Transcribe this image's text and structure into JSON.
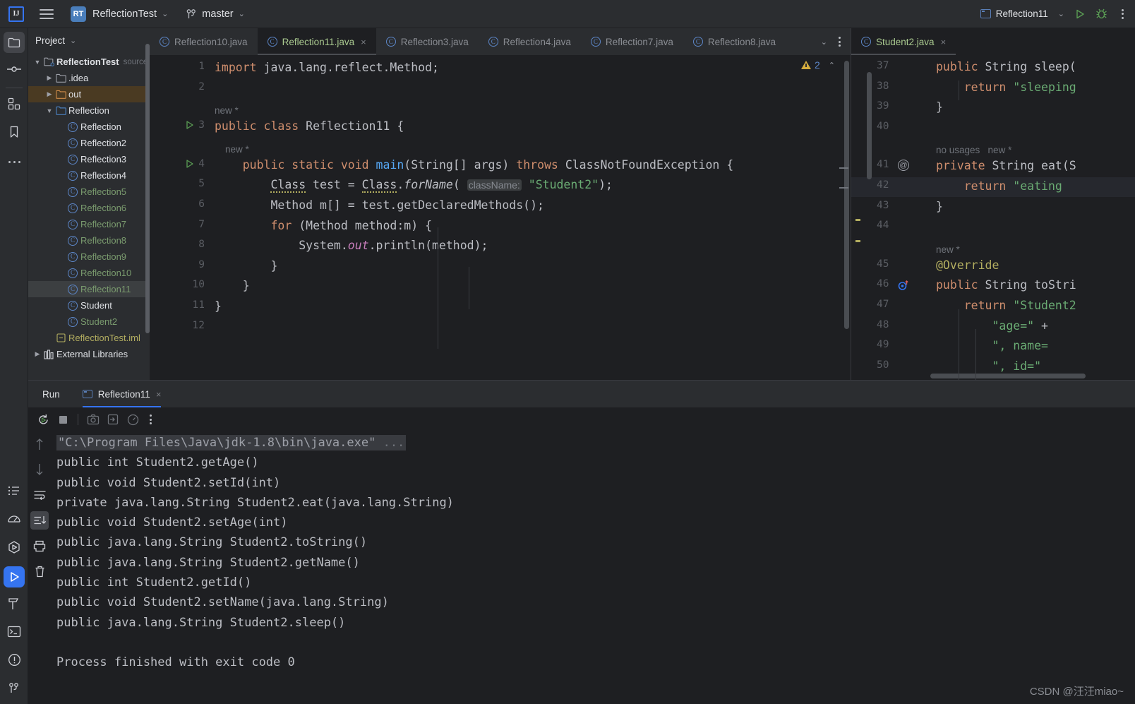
{
  "topbar": {
    "logo_text": "IJ",
    "menu_icon": "hamburger-menu-icon",
    "project_badge": "RT",
    "project_name": "ReflectionTest",
    "branch_name": "master",
    "run_config": "Reflection11",
    "run_icon": "run-play-icon",
    "debug_icon": "debug-bug-icon",
    "more_icon": "more-vertical-icon"
  },
  "stripe": {
    "top_items": [
      "project-icon",
      "commit-icon",
      "structure-icon",
      "bookmarks-icon",
      "more-tool-windows-icon"
    ],
    "bottom_items": [
      "todo-icon",
      "profiler-icon",
      "services-icon",
      "run-icon",
      "build-icon",
      "terminal-icon",
      "problems-icon",
      "git-icon"
    ]
  },
  "project_panel": {
    "title": "Project",
    "tree": [
      {
        "label": "ReflectionTest",
        "suffix": "source",
        "icon": "module-icon",
        "depth": 0,
        "arrow": "down",
        "style": "bold",
        "selected": "none"
      },
      {
        "label": ".idea",
        "suffix": "",
        "icon": "folder-icon",
        "depth": 1,
        "arrow": "right",
        "style": "normal",
        "selected": "none"
      },
      {
        "label": "out",
        "suffix": "",
        "icon": "folder-orange-icon",
        "depth": 1,
        "arrow": "right",
        "style": "normal",
        "selected": "out"
      },
      {
        "label": "Reflection",
        "suffix": "",
        "icon": "folder-blue-icon",
        "depth": 1,
        "arrow": "down",
        "style": "normal",
        "selected": "none"
      },
      {
        "label": "Reflection",
        "suffix": "",
        "icon": "class-icon",
        "depth": 2,
        "arrow": "",
        "style": "white",
        "selected": "none"
      },
      {
        "label": "Reflection2",
        "suffix": "",
        "icon": "class-icon",
        "depth": 2,
        "arrow": "",
        "style": "white",
        "selected": "none"
      },
      {
        "label": "Reflection3",
        "suffix": "",
        "icon": "class-icon",
        "depth": 2,
        "arrow": "",
        "style": "white",
        "selected": "none"
      },
      {
        "label": "Reflection4",
        "suffix": "",
        "icon": "class-icon",
        "depth": 2,
        "arrow": "",
        "style": "white",
        "selected": "none"
      },
      {
        "label": "Reflection5",
        "suffix": "",
        "icon": "class-icon",
        "depth": 2,
        "arrow": "",
        "style": "green",
        "selected": "none"
      },
      {
        "label": "Reflection6",
        "suffix": "",
        "icon": "class-icon",
        "depth": 2,
        "arrow": "",
        "style": "green",
        "selected": "none"
      },
      {
        "label": "Reflection7",
        "suffix": "",
        "icon": "class-icon",
        "depth": 2,
        "arrow": "",
        "style": "green",
        "selected": "none"
      },
      {
        "label": "Reflection8",
        "suffix": "",
        "icon": "class-icon",
        "depth": 2,
        "arrow": "",
        "style": "green",
        "selected": "none"
      },
      {
        "label": "Reflection9",
        "suffix": "",
        "icon": "class-icon",
        "depth": 2,
        "arrow": "",
        "style": "green",
        "selected": "none"
      },
      {
        "label": "Reflection10",
        "suffix": "",
        "icon": "class-icon",
        "depth": 2,
        "arrow": "",
        "style": "green",
        "selected": "none"
      },
      {
        "label": "Reflection11",
        "suffix": "",
        "icon": "class-icon",
        "depth": 2,
        "arrow": "",
        "style": "green",
        "selected": "gray"
      },
      {
        "label": "Student",
        "suffix": "",
        "icon": "class-icon",
        "depth": 2,
        "arrow": "",
        "style": "white",
        "selected": "none"
      },
      {
        "label": "Student2",
        "suffix": "",
        "icon": "class-icon",
        "depth": 2,
        "arrow": "",
        "style": "green",
        "selected": "none"
      },
      {
        "label": "ReflectionTest.iml",
        "suffix": "",
        "icon": "iml-icon",
        "depth": 1,
        "arrow": "",
        "style": "module",
        "selected": "none"
      },
      {
        "label": "External Libraries",
        "suffix": "",
        "icon": "library-icon",
        "depth": 0,
        "arrow": "right",
        "style": "white",
        "selected": "none"
      }
    ]
  },
  "editor_tabs": {
    "left": [
      {
        "label": "Reflection10.java",
        "active": false,
        "closable": false
      },
      {
        "label": "Reflection11.java",
        "active": true,
        "closable": true
      },
      {
        "label": "Reflection3.java",
        "active": false,
        "closable": false
      },
      {
        "label": "Reflection4.java",
        "active": false,
        "closable": false
      },
      {
        "label": "Reflection7.java",
        "active": false,
        "closable": false
      },
      {
        "label": "Reflection8.java",
        "active": false,
        "closable": false
      }
    ],
    "overflow_icon": "chevron-down-icon",
    "options_icon": "more-vertical-icon",
    "right": [
      {
        "label": "Student2.java",
        "active": true,
        "closable": true
      }
    ]
  },
  "editor_main": {
    "file": "Reflection11.java",
    "warning_count": "2",
    "lines": [
      {
        "num": "1",
        "text": "import java.lang.reflect.Method;"
      },
      {
        "num": "2",
        "text": ""
      },
      {
        "num": "",
        "text": "new *",
        "hint": true
      },
      {
        "num": "3",
        "text": "public class Reflection11 {",
        "runmark": true
      },
      {
        "num": "",
        "text": "    new *",
        "hint": true
      },
      {
        "num": "4",
        "text": "    public static void main(String[] args) throws ClassNotFoundException {",
        "runmark": true
      },
      {
        "num": "5",
        "text": "        Class test = Class.forName( className: \"Student2\");"
      },
      {
        "num": "6",
        "text": "        Method m[] = test.getDeclaredMethods();"
      },
      {
        "num": "7",
        "text": "        for (Method method:m) {"
      },
      {
        "num": "8",
        "text": "            System.out.println(method);"
      },
      {
        "num": "9",
        "text": "        }"
      },
      {
        "num": "10",
        "text": "    }"
      },
      {
        "num": "11",
        "text": "}"
      },
      {
        "num": "12",
        "text": ""
      }
    ]
  },
  "editor_right": {
    "file": "Student2.java",
    "lines": [
      {
        "num": "37",
        "text": "public String sleep("
      },
      {
        "num": "38",
        "text": "    return \"sleeping"
      },
      {
        "num": "39",
        "text": "}"
      },
      {
        "num": "40",
        "text": ""
      },
      {
        "num": "",
        "text": "no usages   new *",
        "hint": true
      },
      {
        "num": "41",
        "text": "private String eat(S",
        "marker": "at-icon"
      },
      {
        "num": "42",
        "text": "    return \"eating ",
        "highlight": true
      },
      {
        "num": "43",
        "text": "}"
      },
      {
        "num": "44",
        "text": ""
      },
      {
        "num": "",
        "text": "new *",
        "hint": true
      },
      {
        "num": "45",
        "text": "@Override",
        "annotation": true
      },
      {
        "num": "46",
        "text": "public String toStri",
        "marker": "override-icon"
      },
      {
        "num": "47",
        "text": "    return \"Student2"
      },
      {
        "num": "48",
        "text": "        \"age=\" +"
      },
      {
        "num": "49",
        "text": "        \", name="
      },
      {
        "num": "50",
        "text": "        \", id=\""
      }
    ]
  },
  "run_panel": {
    "title": "Run",
    "tab_label": "Reflection11",
    "tab_close": "×",
    "toolbar": [
      "rerun-icon",
      "stop-icon",
      "screenshot-icon",
      "export-icon",
      "profile-icon",
      "more-vertical-icon"
    ],
    "gutter": [
      "scroll-up-icon",
      "scroll-down-icon",
      "soft-wrap-icon",
      "scroll-to-end-icon",
      "print-icon",
      "clear-all-icon"
    ],
    "console": {
      "command": "\"C:\\Program Files\\Java\\jdk-1.8\\bin\\java.exe\" ...",
      "output": [
        "public int Student2.getAge()",
        "public void Student2.setId(int)",
        "private java.lang.String Student2.eat(java.lang.String)",
        "public void Student2.setAge(int)",
        "public java.lang.String Student2.toString()",
        "public java.lang.String Student2.getName()",
        "public int Student2.getId()",
        "public void Student2.setName(java.lang.String)",
        "public java.lang.String Student2.sleep()",
        "",
        "Process finished with exit code 0"
      ]
    }
  },
  "watermark": "CSDN @汪汪miao~",
  "colors": {
    "bg": "#1e1f22",
    "panel": "#2b2d30",
    "accent": "#3574f0",
    "keyword": "#cf8e6d",
    "string": "#6aab73",
    "method": "#56a8f5",
    "green_file": "#7a9b6e",
    "warning": "#d6ad3e"
  }
}
